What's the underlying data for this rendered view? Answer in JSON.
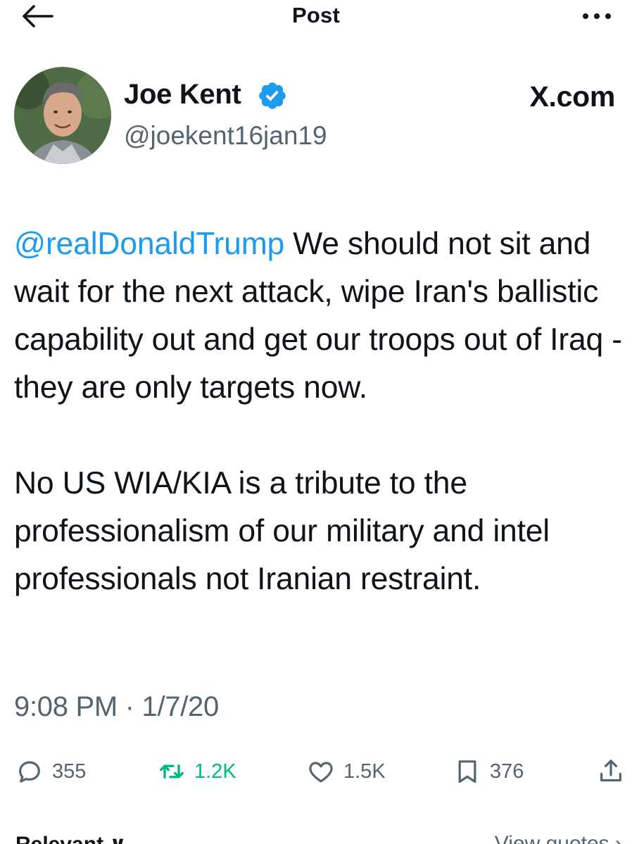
{
  "header": {
    "title": "Post",
    "back_icon": "arrow-left-icon",
    "more_icon": "more-horizontal-icon"
  },
  "author": {
    "name": "Joe Kent",
    "handle": "@joekent16jan19",
    "verified": true,
    "verified_color": "#1d9bf0",
    "avatar_icon": "profile-photo"
  },
  "brand": "X.com",
  "tweet": {
    "mention": "@realDonaldTrump",
    "paragraph1_rest": " We should not sit and wait for the next attack, wipe Iran's ballistic capability out and get our troops out of Iraq - they are only targets now.",
    "paragraph2": "No US WIA/KIA is a tribute to the professionalism of our military and intel professionals not Iranian restraint.",
    "timestamp": "9:08 PM · 1/7/20"
  },
  "actions": {
    "replies": "355",
    "reposts": "1.2K",
    "likes": "1.5K",
    "bookmarks": "376",
    "repost_color": "#00ba7c",
    "icons": [
      "reply-icon",
      "repost-icon",
      "like-icon",
      "bookmark-icon",
      "share-icon"
    ]
  },
  "footer": {
    "relevant_label": "Relevant ∨",
    "view_quotes_label": "View quotes ›"
  },
  "colors": {
    "text": "#0f1419",
    "muted": "#536471",
    "accent": "#1d9bf0"
  }
}
